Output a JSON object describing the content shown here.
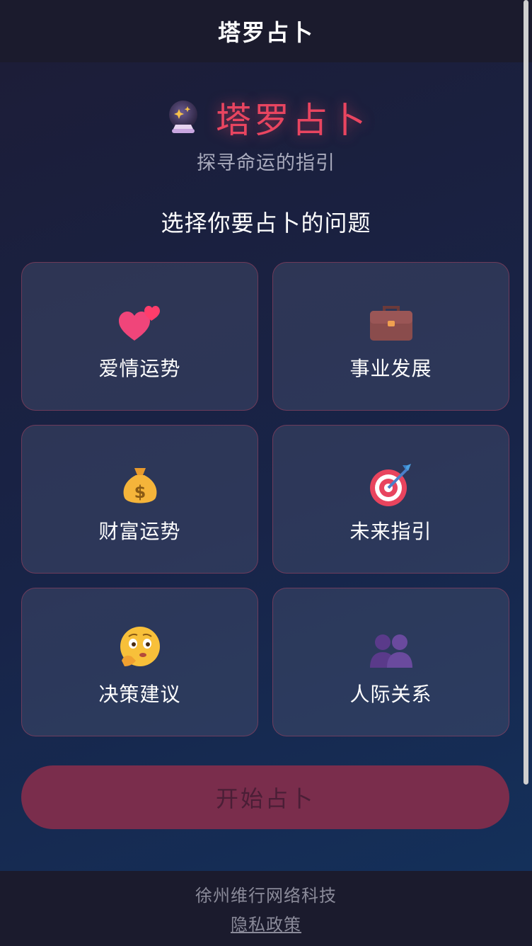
{
  "topbar": {
    "title": "塔罗占卜"
  },
  "hero": {
    "title": "塔罗占卜",
    "subtitle": "探寻命运的指引",
    "icon": "crystal-ball-icon"
  },
  "section": {
    "title": "选择你要占卜的问题"
  },
  "topics": [
    {
      "label": "爱情运势",
      "icon": "two-hearts-icon"
    },
    {
      "label": "事业发展",
      "icon": "briefcase-icon"
    },
    {
      "label": "财富运势",
      "icon": "money-bag-icon"
    },
    {
      "label": "未来指引",
      "icon": "target-icon"
    },
    {
      "label": "决策建议",
      "icon": "thinking-face-icon"
    },
    {
      "label": "人际关系",
      "icon": "people-icon"
    }
  ],
  "start_button": {
    "label": "开始占卜"
  },
  "footer": {
    "company": "徐州维行网络科技",
    "privacy_link": "隐私政策"
  },
  "colors": {
    "accent": "#e94560",
    "card_border": "#e94560",
    "start_button_bg": "#7a2d4c",
    "bar_bg": "#1b1b2d"
  }
}
